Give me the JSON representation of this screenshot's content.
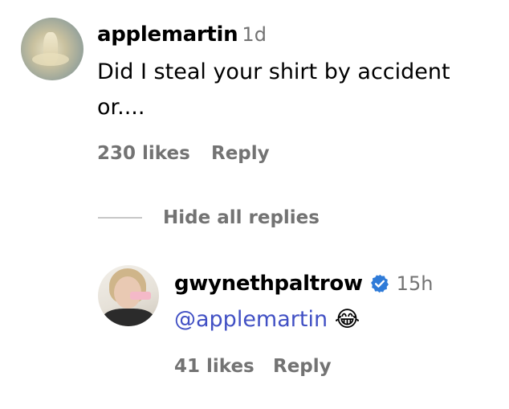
{
  "comments": [
    {
      "username": "applemartin",
      "time": "1d",
      "text_line1": "Did I steal your shirt by accident",
      "text_line2": "or....",
      "likes": "230 likes",
      "reply_label": "Reply"
    }
  ],
  "replies_toggle": "Hide all replies",
  "replies": [
    {
      "username": "gwynethpaltrow",
      "time": "15h",
      "mention": "@applemartin",
      "emoji": "😂",
      "likes": "41 likes",
      "reply_label": "Reply"
    }
  ],
  "colors": {
    "mention": "#4150c4",
    "verified": "#2f7bd8",
    "muted": "#737373"
  }
}
